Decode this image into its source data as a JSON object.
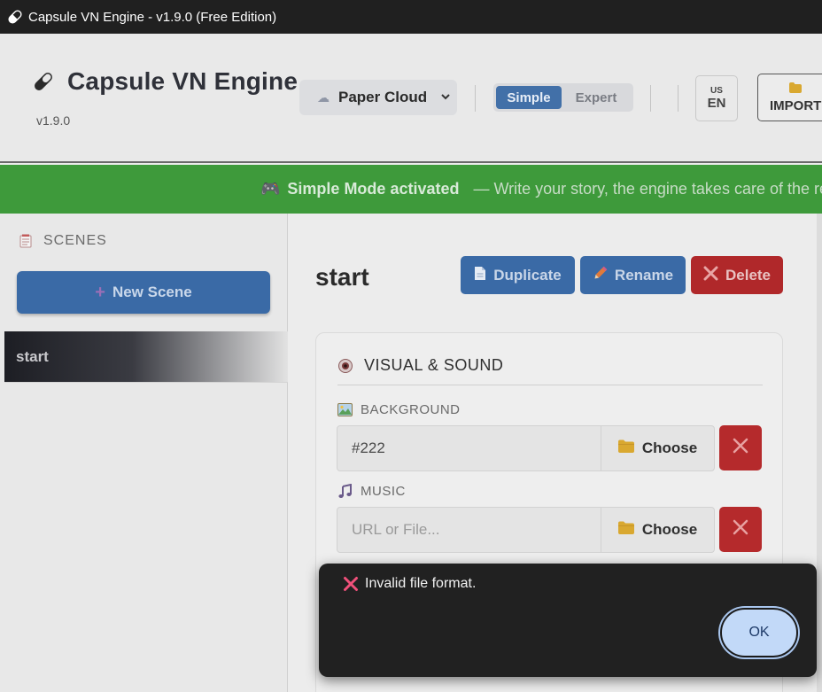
{
  "window": {
    "title": "Capsule VN Engine - v1.9.0 (Free Edition)",
    "icon": "capsule-icon"
  },
  "header": {
    "app_name": "Capsule VN Engine",
    "version": "v1.9.0",
    "theme": {
      "selected": "Paper Cloud",
      "icon": "cloud-icon"
    },
    "mode": {
      "simple_label": "Simple",
      "expert_label": "Expert",
      "active": "Simple"
    },
    "language": {
      "flag": "US",
      "code": "EN"
    },
    "import_label": "IMPORT"
  },
  "banner": {
    "icon": "gamepad-icon",
    "title": "Simple Mode activated",
    "description": "— Write your story, the engine takes care of the rest"
  },
  "sidebar": {
    "header": "SCENES",
    "new_scene_label": "New Scene",
    "scenes": [
      {
        "name": "start",
        "selected": true
      }
    ]
  },
  "scene": {
    "title": "start",
    "actions": {
      "duplicate": "Duplicate",
      "rename": "Rename",
      "delete": "Delete"
    }
  },
  "visual_sound": {
    "title": "VISUAL & SOUND",
    "background": {
      "label": "BACKGROUND",
      "value": "#222",
      "choose_label": "Choose"
    },
    "music": {
      "label": "MUSIC",
      "placeholder": "URL or File...",
      "choose_label": "Choose"
    }
  },
  "dialog": {
    "message": "Invalid file format.",
    "ok_label": "OK"
  },
  "colors": {
    "accent_blue": "#3a6aa6",
    "danger_red": "#b0282a",
    "banner_green": "#3e9a3b",
    "dialog_bg": "#212121"
  }
}
